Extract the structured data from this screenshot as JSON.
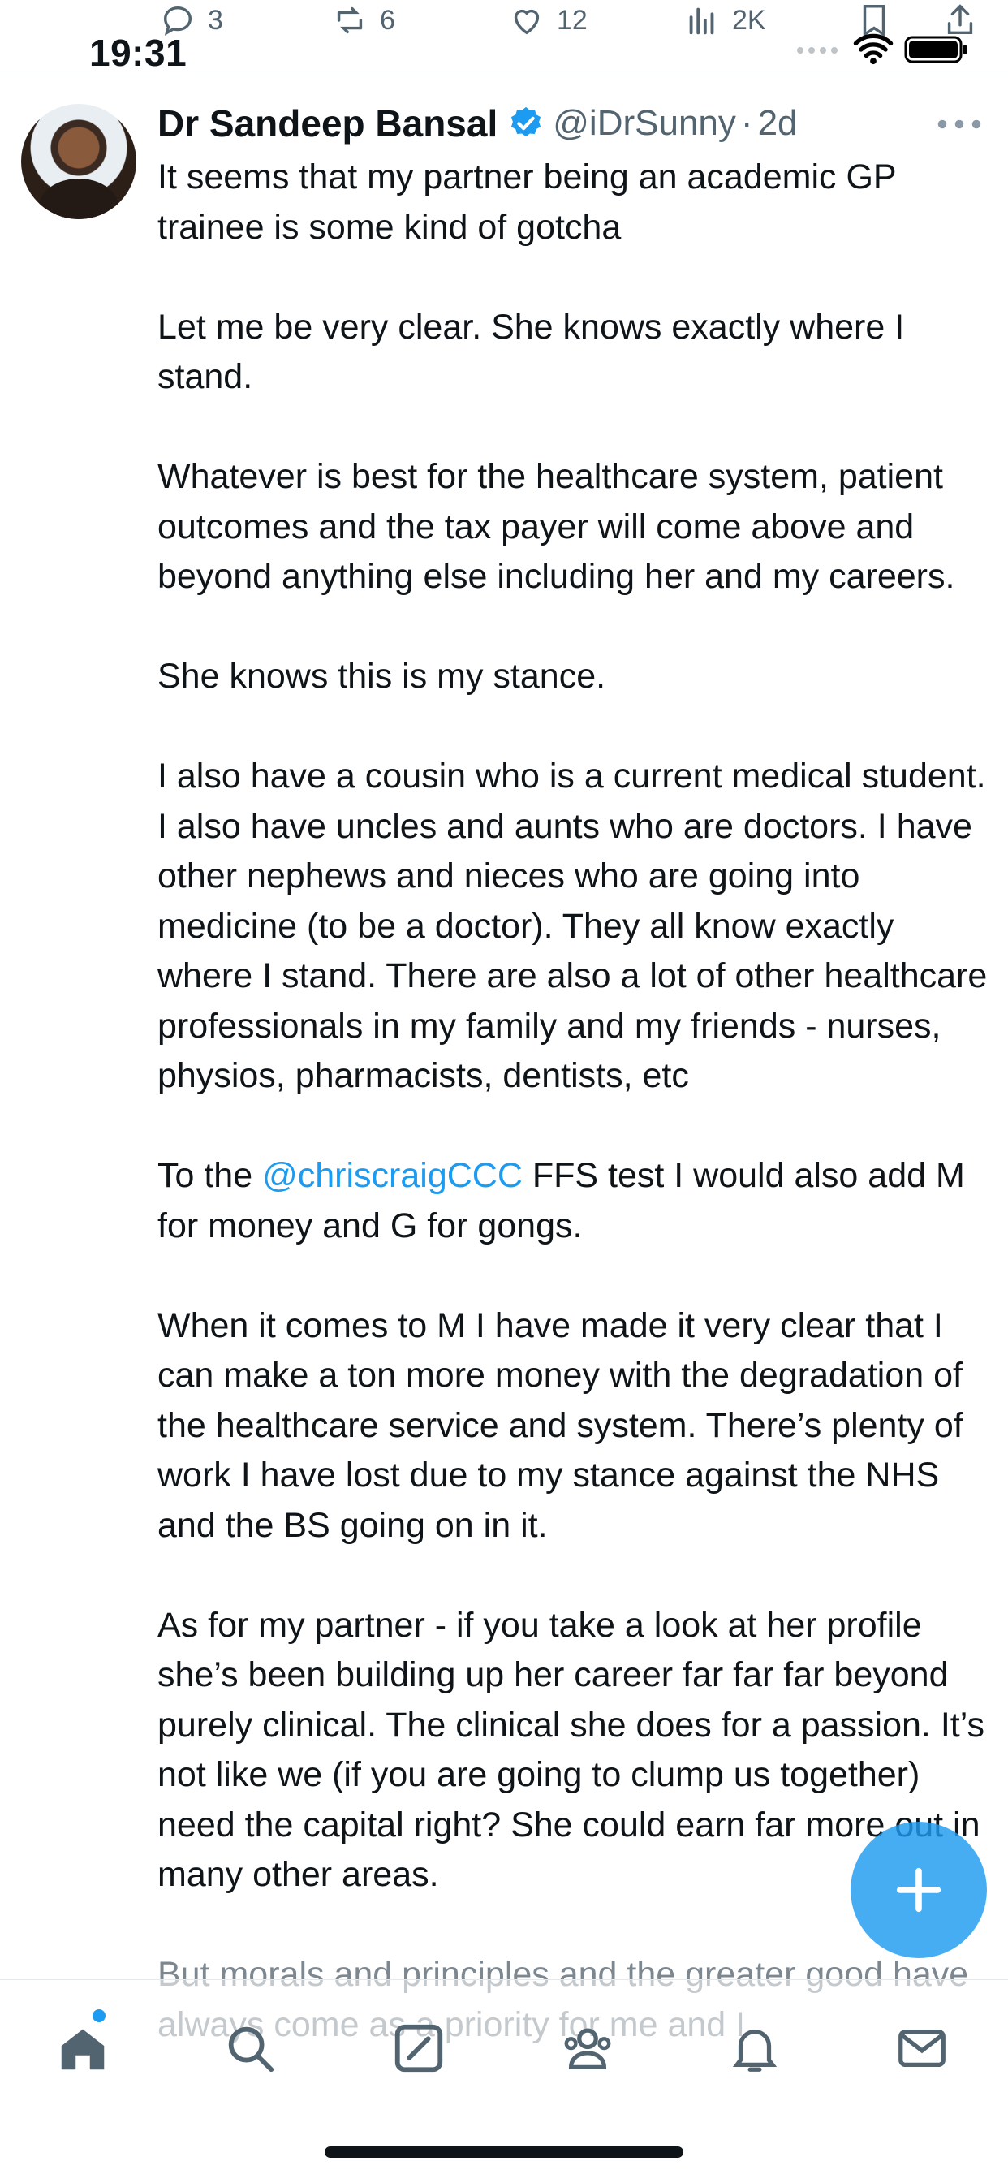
{
  "status_bar": {
    "time": "19:31"
  },
  "prev_tweet_actions": {
    "replies": "3",
    "reposts": "6",
    "likes": "12",
    "views": "2K"
  },
  "tweet": {
    "author_name": "Dr Sandeep Bansal",
    "handle": "@iDrSunny",
    "separator": "·",
    "time_ago": "2d",
    "paragraphs": [
      "It seems that my partner being an academic GP trainee is some kind of gotcha",
      "Let me be very clear. She knows exactly where I stand.",
      "Whatever is best for the healthcare system, patient outcomes and the tax payer will come above and beyond anything else including her and my careers.",
      "She knows this is my stance.",
      "I also have a cousin who is a current medical student. I also have uncles and aunts who are doctors. I have other nephews and nieces who are going into medicine (to be a doctor). They all know exactly where I stand. There are also a lot of other healthcare professionals in my family and my friends - nurses, physios, pharmacists, dentists, etc"
    ],
    "mention_para": {
      "before": "To the ",
      "mention": "@chriscraigCCC",
      "after": " FFS test I would also add M for money and G for gongs."
    },
    "paragraphs_2": [
      "When it comes to M I have made it very clear that I can make a ton more money with the degradation of the healthcare service and system. There’s plenty of work I have lost due to my stance against the NHS and the BS going on in it.",
      "As for my partner - if you take a look at her profile she’s been building up her career far far far beyond purely clinical. The clinical she does for a passion. It’s not like we (if you are going to clump us together) need the capital right? She could earn far more out in many other areas."
    ],
    "faded_para": "But morals and principles and the greater good have always come as a priority for me and I"
  },
  "colors": {
    "accent": "#1d9bf0",
    "text": "#0f1419",
    "secondary": "#536471"
  },
  "bottom_nav": [
    "home-icon",
    "search-icon",
    "grok-icon",
    "communities-icon",
    "notifications-icon",
    "messages-icon"
  ]
}
